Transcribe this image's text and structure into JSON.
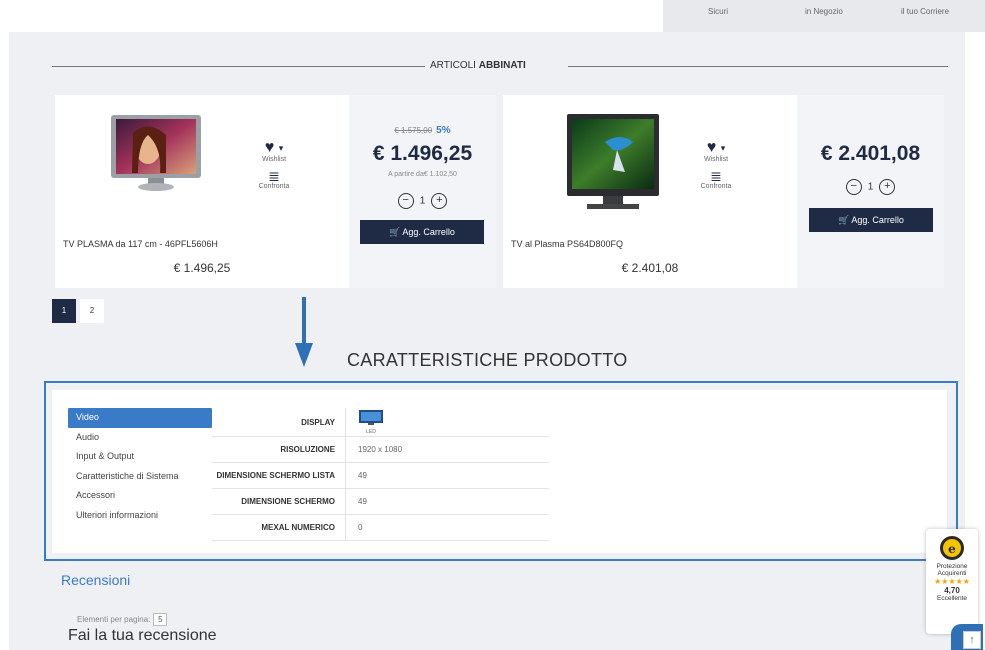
{
  "top_strip": {
    "items": [
      "Sicuri",
      "in Negozio",
      "il tuo Corriere"
    ]
  },
  "section": {
    "title_light": "ARTICOLI",
    "title_bold": "ABBINATI"
  },
  "products": [
    {
      "name": "TV PLASMA da 117 cm - 46PFL5606H",
      "price_under_name": "€ 1.496,25",
      "old_price": "€ 1.575,00",
      "discount": "5%",
      "price": "€ 1.496,25",
      "from_price": "A partire da€ 1.102,50",
      "qty": "1",
      "wishlist_label": "Wishlist",
      "compare_label": "Confronta",
      "cart_label": "Agg. Carrello"
    },
    {
      "name": "TV al Plasma PS64D800FQ",
      "price_under_name": "€ 2.401,08",
      "price": "€ 2.401,08",
      "qty": "1",
      "wishlist_label": "Wishlist",
      "compare_label": "Confronta",
      "cart_label": "Agg. Carrello"
    }
  ],
  "pagination": {
    "pages": [
      "1",
      "2"
    ],
    "current": "1"
  },
  "features": {
    "title": "CARATTERISTICHE PRODOTTO",
    "tabs": [
      "Video",
      "Audio",
      "Input & Output",
      "Caratteristiche di Sistema",
      "Accessori",
      "Ulteriori informazioni"
    ],
    "active_tab": "Video",
    "rows": [
      {
        "label": "DISPLAY",
        "value": "",
        "icon_caption": "LED"
      },
      {
        "label": "RISOLUZIONE",
        "value": "1920 x 1080"
      },
      {
        "label": "DIMENSIONE SCHERMO LISTA",
        "value": "49"
      },
      {
        "label": "DIMENSIONE SCHERMO",
        "value": "49"
      },
      {
        "label": "MEXAL NUMERICO",
        "value": "0"
      }
    ]
  },
  "reviews": {
    "title": "Recensioni",
    "per_page_label": "Elementi per pagina:",
    "per_page_value": "5",
    "write_title": "Fai la tua recensione"
  },
  "trust_badge": {
    "line1": "Protezione",
    "line2": "Acquirenti",
    "stars": "★★★★★",
    "score": "4,70",
    "rating_label": "Eccellente"
  },
  "colors": {
    "navy": "#1f2a44",
    "accent_blue": "#3a7bc8",
    "background": "#eef0f3"
  }
}
